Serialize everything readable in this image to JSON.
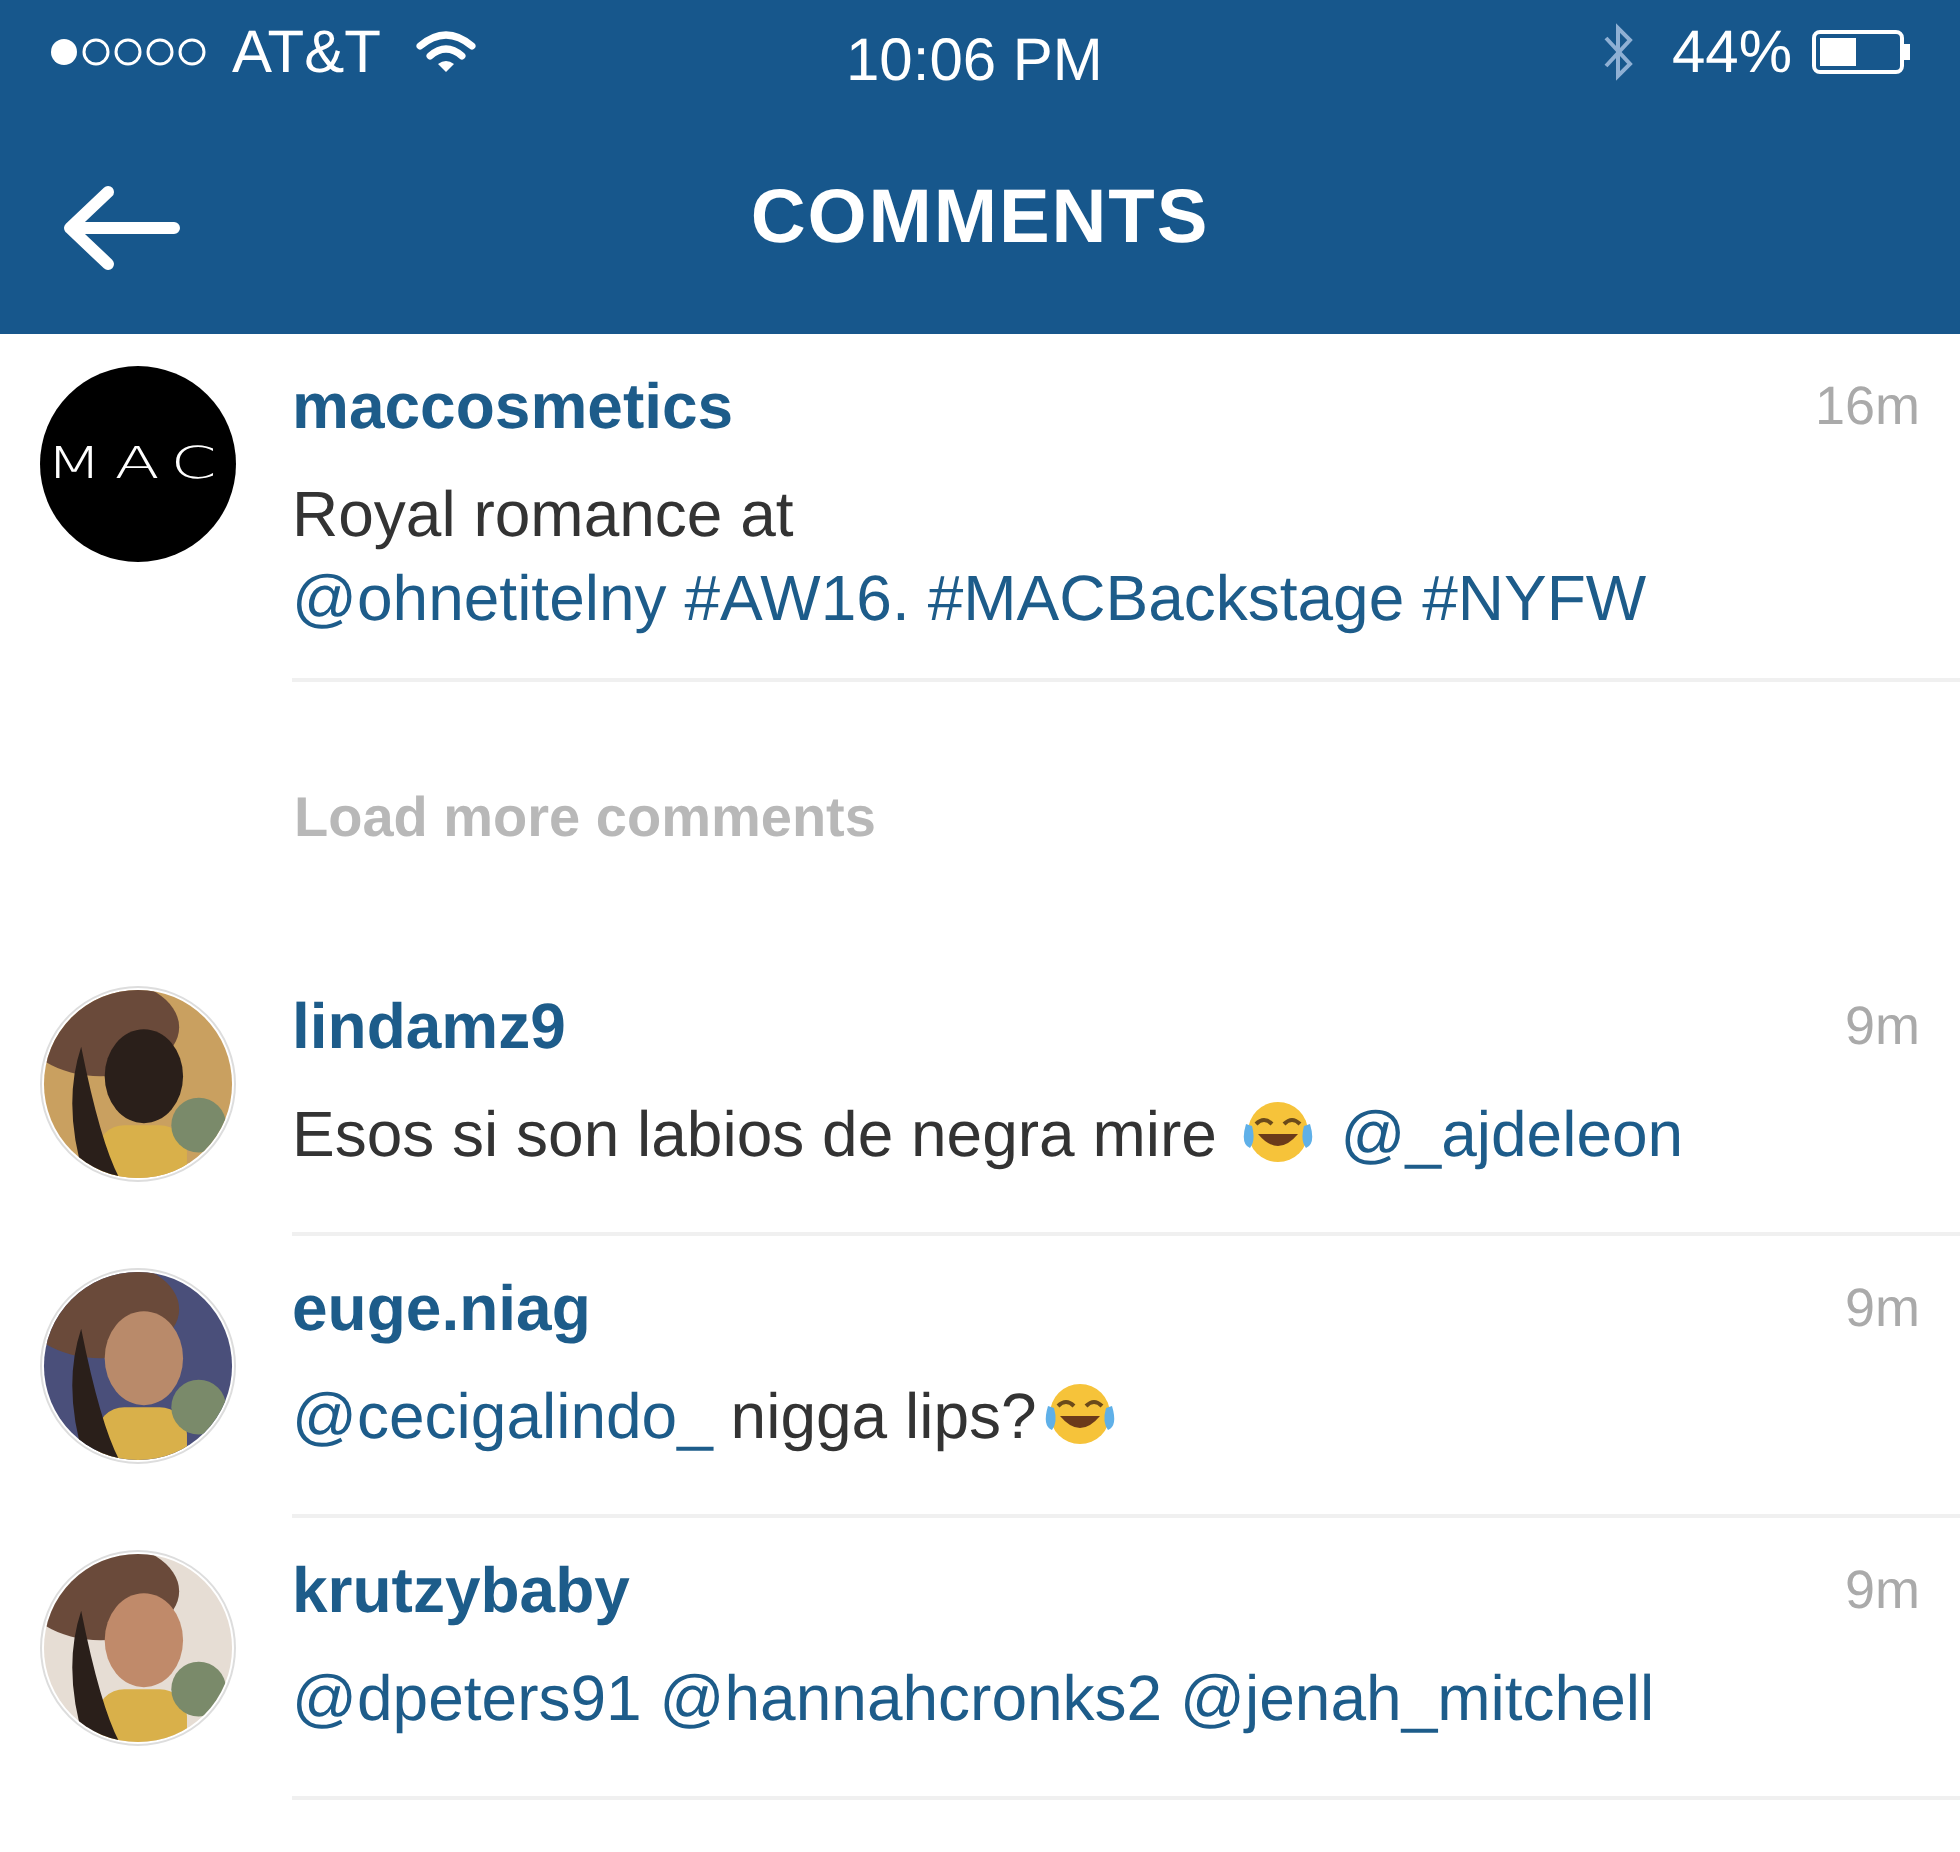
{
  "status_bar": {
    "carrier": "AT&T",
    "time": "10:06 PM",
    "battery": "44%"
  },
  "header": {
    "title": "COMMENTS"
  },
  "caption": {
    "avatar_text": "MAC",
    "username": "maccosmetics",
    "time": "16m",
    "parts": [
      {
        "kind": "text",
        "text": "Royal romance at "
      },
      {
        "kind": "link",
        "text": "@ohnetitelny"
      },
      {
        "kind": "link",
        "text": "#AW16."
      },
      {
        "kind": "link",
        "text": "#MACBackstage"
      },
      {
        "kind": "link",
        "text": "#NYFW"
      }
    ]
  },
  "load_more": "Load more comments",
  "comments": [
    {
      "username": "lindamz9",
      "time": "9m",
      "parts": [
        {
          "kind": "text",
          "text": "Esos si son labios de negra mire "
        },
        {
          "kind": "emoji"
        },
        {
          "kind": "link",
          "text": "@_ajdeleon"
        }
      ]
    },
    {
      "username": "euge.niag",
      "time": "9m",
      "parts": [
        {
          "kind": "link",
          "text": "@cecigalindo_"
        },
        {
          "kind": "text",
          "text": " nigga lips?"
        },
        {
          "kind": "emoji"
        }
      ]
    },
    {
      "username": "krutzybaby",
      "time": "9m",
      "parts": [
        {
          "kind": "link",
          "text": "@dpeters91"
        },
        {
          "kind": "link",
          "text": "@hannahcronks2"
        },
        {
          "kind": "link",
          "text": "@jenah_mitchell"
        }
      ]
    }
  ]
}
